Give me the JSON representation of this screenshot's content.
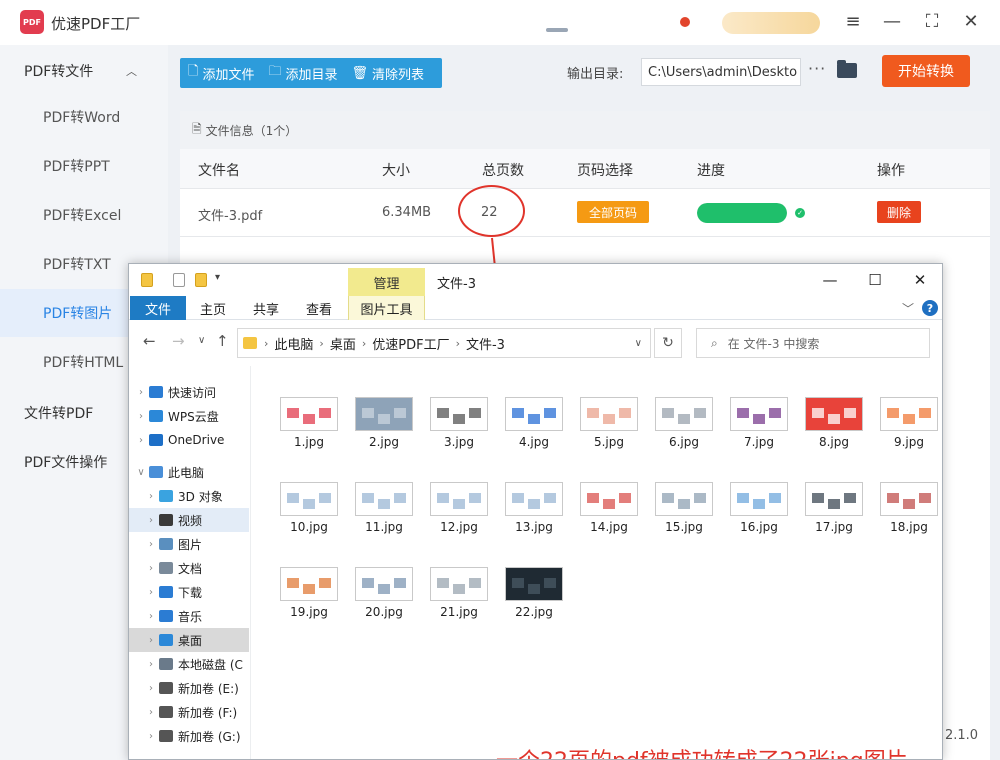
{
  "app": {
    "title": "优速PDF工厂",
    "logo_text": "PDF",
    "window_controls": [
      "≡",
      "—",
      "⛶",
      "✕"
    ]
  },
  "sidebar": {
    "groups": [
      {
        "label": "PDF转文件",
        "expanded": true
      },
      {
        "label": "文件转PDF",
        "expanded": false
      },
      {
        "label": "PDF文件操作",
        "expanded": false
      }
    ],
    "items": [
      {
        "label": "PDF转Word"
      },
      {
        "label": "PDF转PPT"
      },
      {
        "label": "PDF转Excel"
      },
      {
        "label": "PDF转TXT"
      },
      {
        "label": "PDF转图片",
        "active": true
      },
      {
        "label": "PDF转HTML"
      }
    ]
  },
  "toolbar": {
    "add_file": "添加文件",
    "add_folder": "添加目录",
    "clear_list": "清除列表",
    "output_label": "输出目录:",
    "output_path": "C:\\Users\\admin\\Deskto",
    "more": "···",
    "start": "开始转换"
  },
  "file_panel": {
    "header": "文件信息（1个）",
    "columns": [
      "文件名",
      "大小",
      "总页数",
      "页码选择",
      "进度",
      "操作"
    ],
    "rows": [
      {
        "name": "文件-3.pdf",
        "size": "6.34MB",
        "pages": "22",
        "page_select": "全部页码",
        "progress": 1.0,
        "action": "删除"
      }
    ]
  },
  "version": "2.1.0",
  "explorer": {
    "title": "文件-3",
    "manage_tab": "管理",
    "ribbon": {
      "file": "文件",
      "home": "主页",
      "share": "共享",
      "view": "查看",
      "tools": "图片工具"
    },
    "address": [
      "此电脑",
      "桌面",
      "优速PDF工厂",
      "文件-3"
    ],
    "search_placeholder": "在 文件-3 中搜索",
    "help": "?",
    "nav": [
      {
        "label": "快速访问",
        "icon": "star-icon",
        "color": "#2b7cd3"
      },
      {
        "label": "WPS云盘",
        "icon": "cloud-icon",
        "color": "#2b88d8"
      },
      {
        "label": "OneDrive",
        "icon": "onedrive-icon",
        "color": "#1d6fc7"
      },
      {
        "label": "此电脑",
        "icon": "computer-icon",
        "color": "#4a8fd8"
      },
      {
        "label": "3D 对象",
        "icon": "cube-icon",
        "color": "#3aa3e0"
      },
      {
        "label": "视频",
        "icon": "film-icon",
        "color": "#3a3a3a"
      },
      {
        "label": "图片",
        "icon": "picture-icon",
        "color": "#5a8fbf"
      },
      {
        "label": "文档",
        "icon": "document-icon",
        "color": "#7a8a9a"
      },
      {
        "label": "下载",
        "icon": "download-icon",
        "color": "#2b7cd3"
      },
      {
        "label": "音乐",
        "icon": "music-icon",
        "color": "#2b7cd3"
      },
      {
        "label": "桌面",
        "icon": "desktop-icon",
        "color": "#2b88d8"
      },
      {
        "label": "本地磁盘 (C",
        "icon": "drive-c-icon",
        "color": "#6a7a8a"
      },
      {
        "label": "新加卷 (E:)",
        "icon": "drive-icon",
        "color": "#555555"
      },
      {
        "label": "新加卷 (F:)",
        "icon": "drive-icon",
        "color": "#555555"
      },
      {
        "label": "新加卷 (G:)",
        "icon": "drive-icon",
        "color": "#555555"
      }
    ],
    "files": [
      "1.jpg",
      "2.jpg",
      "3.jpg",
      "4.jpg",
      "5.jpg",
      "6.jpg",
      "7.jpg",
      "8.jpg",
      "9.jpg",
      "10.jpg",
      "11.jpg",
      "12.jpg",
      "13.jpg",
      "14.jpg",
      "15.jpg",
      "16.jpg",
      "17.jpg",
      "18.jpg",
      "19.jpg",
      "20.jpg",
      "21.jpg",
      "22.jpg"
    ]
  },
  "annotation": "一个22页的pdf被成功转成了22张jpg图片",
  "colors": {
    "accent": "#2d9cdb",
    "start": "#f05a1e",
    "active_side": "#2a84e4",
    "annotation": "#e0342b",
    "progress": "#1fbf6b"
  }
}
